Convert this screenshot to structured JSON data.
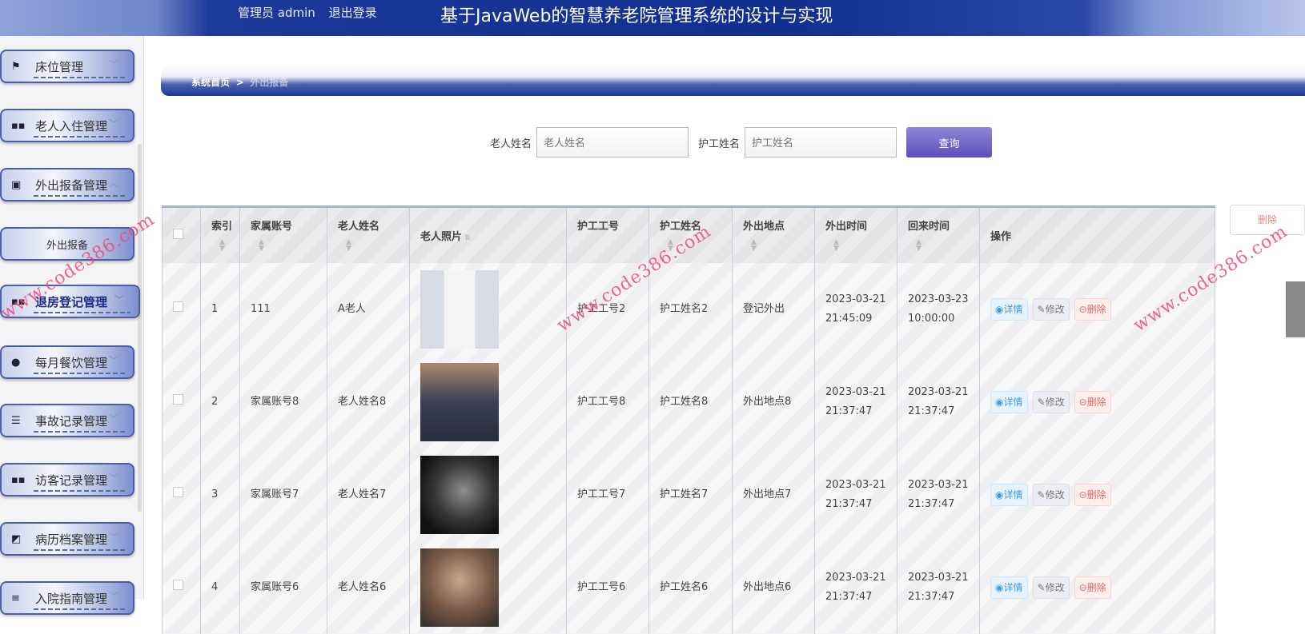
{
  "header": {
    "user_label": "管理员 admin",
    "logout": "退出登录",
    "title": "基于JavaWeb的智慧养老院管理系统的设计与实现"
  },
  "sidebar": {
    "items": [
      {
        "label": "床位管理",
        "icon": "flag-icon"
      },
      {
        "label": "老人入住管理",
        "icon": "grid-icon"
      },
      {
        "label": "外出报备管理",
        "icon": "clipboard-icon",
        "expanded": true
      },
      {
        "label": "外出报备",
        "sub": true
      },
      {
        "label": "退房登记管理",
        "icon": "grid-icon",
        "active": true
      },
      {
        "label": "每月餐饮管理",
        "icon": "bulb-icon"
      },
      {
        "label": "事故记录管理",
        "icon": "sliders-icon"
      },
      {
        "label": "访客记录管理",
        "icon": "grid-icon"
      },
      {
        "label": "病历档案管理",
        "icon": "chart-icon"
      },
      {
        "label": "入院指南管理",
        "icon": "list-icon"
      }
    ]
  },
  "breadcrumb": {
    "home": "系统首页",
    "sep": ">",
    "current": "外出报备"
  },
  "search": {
    "elder_label": "老人姓名",
    "elder_placeholder": "老人姓名",
    "nurse_label": "护工姓名",
    "nurse_placeholder": "护工姓名",
    "button": "查询"
  },
  "toolbar": {
    "delete": "删除"
  },
  "table": {
    "headers": [
      "索引",
      "家属账号",
      "老人姓名",
      "老人照片",
      "护工工号",
      "护工姓名",
      "外出地点",
      "外出时间",
      "回来时间",
      "操作"
    ],
    "actions": {
      "detail": "详情",
      "edit": "修改",
      "delete": "删除"
    },
    "rows": [
      {
        "index": "1",
        "family": "111",
        "elder": "A老人",
        "photo": "man-in-shirt",
        "nurse_id": "护工工号2",
        "nurse": "护工姓名2",
        "place": "登记外出",
        "out": "2023-03-21 21:45:09",
        "back": "2023-03-23 10:00:00"
      },
      {
        "index": "2",
        "family": "家属账号8",
        "elder": "老人姓名8",
        "photo": "elderly-couple",
        "nurse_id": "护工工号8",
        "nurse": "护工姓名8",
        "place": "外出地点8",
        "out": "2023-03-21 21:37:47",
        "back": "2023-03-21 21:37:47"
      },
      {
        "index": "3",
        "family": "家属账号7",
        "elder": "老人姓名7",
        "photo": "elderly-man-dark",
        "nurse_id": "护工工号7",
        "nurse": "护工姓名7",
        "place": "外出地点7",
        "out": "2023-03-21 21:37:47",
        "back": "2023-03-21 21:37:47"
      },
      {
        "index": "4",
        "family": "家属账号6",
        "elder": "老人姓名6",
        "photo": "elderly-man-smoking",
        "nurse_id": "护工工号6",
        "nurse": "护工姓名6",
        "place": "外出地点6",
        "out": "2023-03-21 21:37:47",
        "back": "2023-03-21 21:37:47"
      }
    ]
  },
  "watermark": "www.code386.com",
  "colors": {
    "brand": "#102f8e",
    "query": "#6b5fc4",
    "danger": "#e26a6a",
    "info": "#3e9be0"
  }
}
